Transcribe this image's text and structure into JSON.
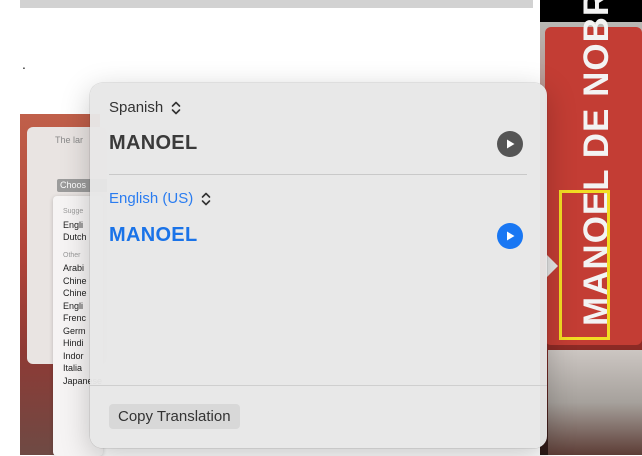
{
  "background": {
    "left_panel_text": "The lar",
    "choose_label": "Choos",
    "suggested_header": "Sugge",
    "suggested_items": [
      "Engli",
      "Dutch"
    ],
    "other_header": "Other",
    "other_items": [
      "Arabi",
      "Chine",
      "Chine",
      "Engli",
      "Frenc",
      "Germ",
      "Hindi",
      "Indor",
      "Italia",
      "Japanese"
    ],
    "video_text": "MANOEL DE NOBRE"
  },
  "popover": {
    "source_language": "Spanish",
    "source_text": "MANOEL",
    "target_language": "English (US)",
    "target_text": "MANOEL",
    "copy_button": "Copy Translation"
  },
  "colors": {
    "accent": "#1a73e8",
    "highlight_box": "#f2dd23"
  },
  "icons": {
    "language_selector": "chevron-up-down-icon",
    "play": "play-icon"
  }
}
